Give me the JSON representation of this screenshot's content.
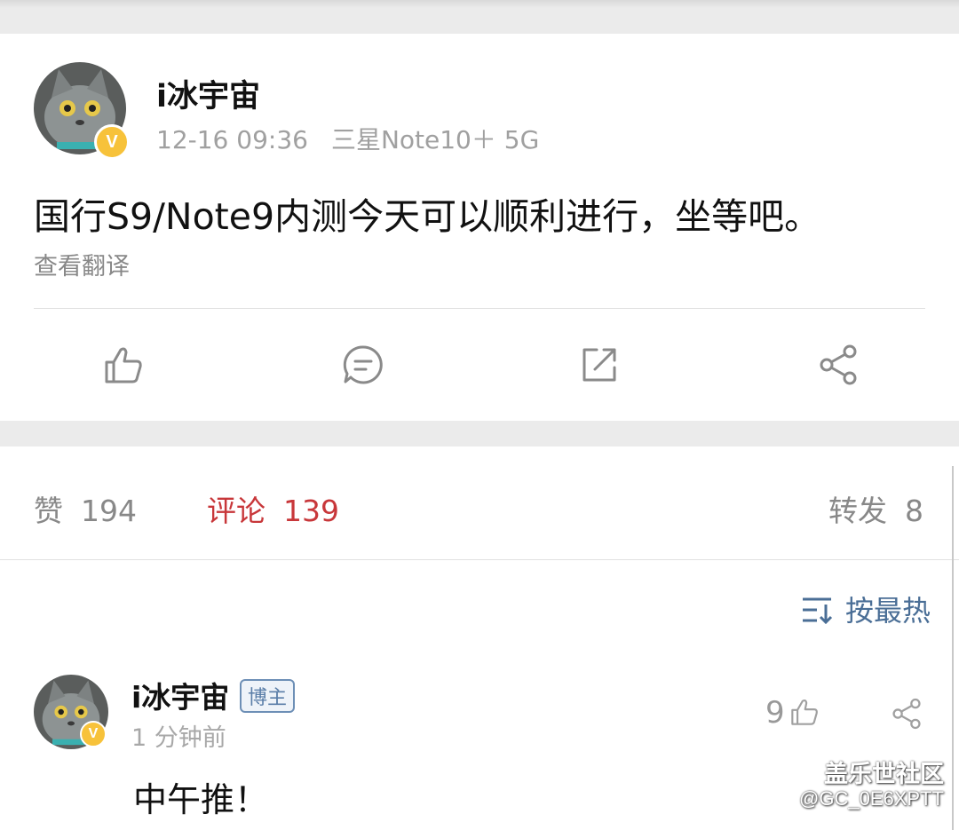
{
  "post": {
    "author": "i冰宇宙",
    "time": "12-16 09:36",
    "device": "三星Note10＋ 5G",
    "content": "国行S9/Note9内测今天可以顺利进行，坐等吧。",
    "translate_label": "查看翻译",
    "verified_badge": "V",
    "actions": [
      "like-icon",
      "comment-icon",
      "repost-icon",
      "share-icon"
    ]
  },
  "stats": {
    "like_label": "赞",
    "like_count": "194",
    "comment_label": "评论",
    "comment_count": "139",
    "repost_label": "转发",
    "repost_count": "8"
  },
  "sort": {
    "label": "按最热",
    "icon": "sort-icon"
  },
  "comment": {
    "author": "i冰宇宙",
    "tag": "博主",
    "time": "1 分钟前",
    "text": "中午推！",
    "likes": "9",
    "verified_badge": "V"
  },
  "watermark": {
    "line1": "盖乐世社区",
    "line2": "@GC_0E6XPTT"
  },
  "colors": {
    "accent_red": "#c8373a",
    "link_blue": "#4a6e96",
    "badge_yellow": "#f7c23a"
  }
}
